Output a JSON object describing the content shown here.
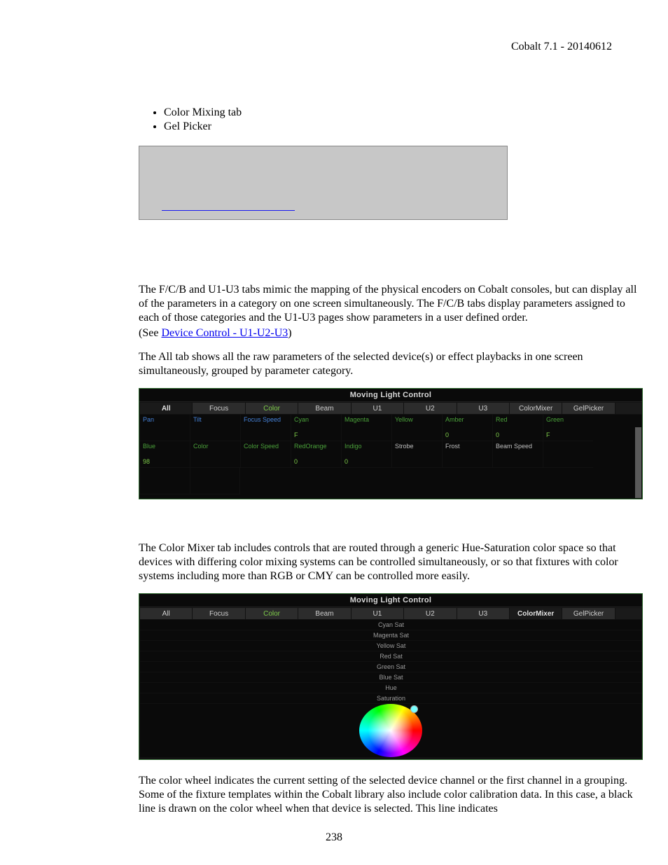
{
  "header": "Cobalt 7.1 - 20140612",
  "page_number": "238",
  "bullets": [
    "Color Mixing tab",
    "Gel Picker"
  ],
  "p1a": "The F/C/B and U1-U3 tabs mimic the mapping of the physical encoders on Cobalt consoles, but can display all of the parameters in a category on one screen simultaneously. The F/C/B tabs display parameters assigned to each of those categories and the U1-U3 pages show parameters in a user defined order.",
  "p1b_pre": "(See ",
  "p1b_link": "Device Control - U1-U2-U3",
  "p1b_post": ")",
  "p2": "The All tab shows all the raw parameters of the selected device(s) or effect playbacks in one screen simultaneously, grouped by parameter category.",
  "p3": "The Color Mixer tab includes controls that are routed through a generic Hue-Saturation color space so that devices with differing color mixing systems can be controlled simultaneously, or so that fixtures with color systems including more than RGB or CMY can be controlled more easily.",
  "p4": "The color wheel indicates the current setting of the selected device channel or the first channel in a grouping. Some of the fixture templates within the Cobalt library also include color calibration data. In this case, a black line is drawn on the color wheel when that device is selected. This line indicates",
  "mlc_title": "Moving Light Control",
  "tabs": {
    "all": "All",
    "focus": "Focus",
    "color": "Color",
    "beam": "Beam",
    "u1": "U1",
    "u2": "U2",
    "u3": "U3",
    "mixer": "ColorMixer",
    "gel": "GelPicker"
  },
  "fig1_params": [
    {
      "l": "Pan",
      "c": "b",
      "v": ""
    },
    {
      "l": "Tilt",
      "c": "b",
      "v": ""
    },
    {
      "l": "Focus Speed",
      "c": "b",
      "v": ""
    },
    {
      "l": "Cyan",
      "c": "g",
      "v": "F"
    },
    {
      "l": "Magenta",
      "c": "g",
      "v": ""
    },
    {
      "l": "Yellow",
      "c": "g",
      "v": ""
    },
    {
      "l": "Amber",
      "c": "g",
      "v": "0"
    },
    {
      "l": "Red",
      "c": "g",
      "v": "0"
    },
    {
      "l": "Green",
      "c": "g",
      "v": "F"
    },
    {
      "l": "Blue",
      "c": "g",
      "v": "98"
    },
    {
      "l": "Color",
      "c": "g",
      "v": ""
    },
    {
      "l": "Color Speed",
      "c": "g",
      "v": ""
    },
    {
      "l": "RedOrange",
      "c": "g",
      "v": "0"
    },
    {
      "l": "Indigo",
      "c": "g",
      "v": "0"
    },
    {
      "l": "Strobe",
      "c": "w",
      "v": ""
    },
    {
      "l": "Frost",
      "c": "w",
      "v": ""
    },
    {
      "l": "Beam Speed",
      "c": "w",
      "v": ""
    },
    {
      "l": "",
      "c": "w",
      "v": ""
    },
    {
      "l": "",
      "c": "w",
      "v": ""
    },
    {
      "l": "",
      "c": "w",
      "v": ""
    }
  ],
  "fig2_labels": {
    "cyan": "Cyan Sat",
    "mag": "Magenta Sat",
    "yel": "Yellow Sat",
    "red": "Red Sat",
    "grn": "Green Sat",
    "blu": "Blue Sat",
    "hue": "Hue",
    "sat": "Saturation"
  }
}
